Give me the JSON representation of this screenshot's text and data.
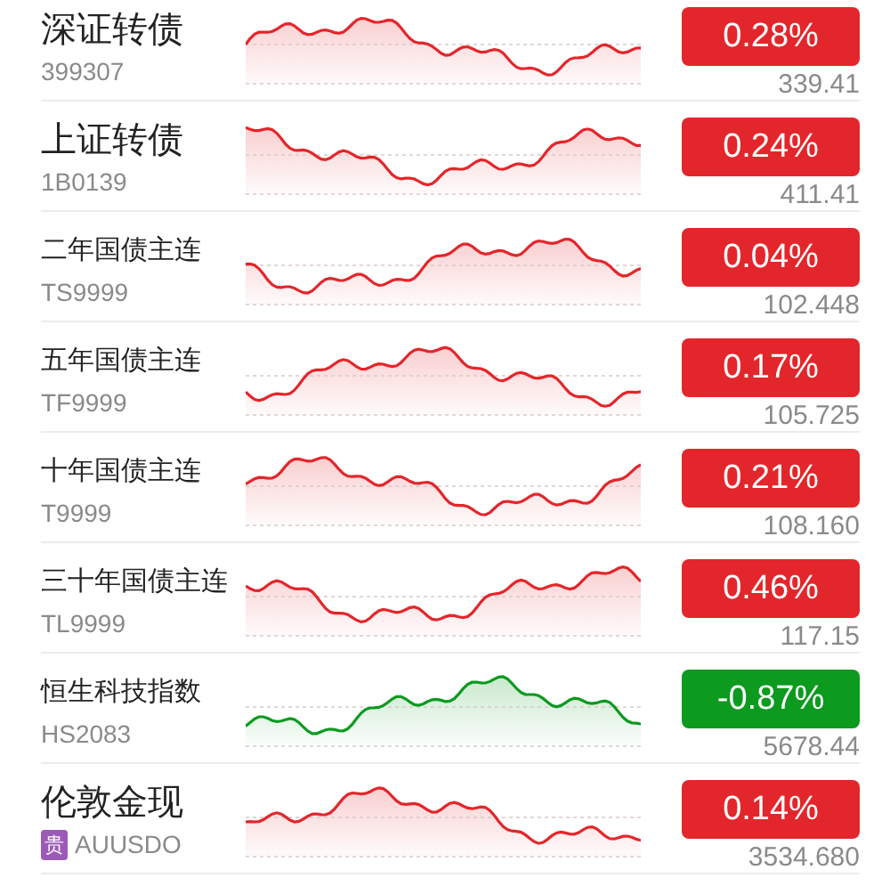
{
  "rows": [
    {
      "name": "深证转债",
      "code": "399307",
      "change": "0.28%",
      "price": "339.41",
      "color": "#e3262b"
    },
    {
      "name": "上证转债",
      "code": "1B0139",
      "change": "0.24%",
      "price": "411.41",
      "color": "#e3262b"
    },
    {
      "name": "二年国债主连",
      "code": "TS9999",
      "change": "0.04%",
      "price": "102.448",
      "color": "#e3262b"
    },
    {
      "name": "五年国债主连",
      "code": "TF9999",
      "change": "0.17%",
      "price": "105.725",
      "color": "#e3262b"
    },
    {
      "name": "十年国债主连",
      "code": "T9999",
      "change": "0.21%",
      "price": "108.160",
      "color": "#e3262b"
    },
    {
      "name": "三十年国债主连",
      "code": "TL9999",
      "change": "0.46%",
      "price": "117.15",
      "color": "#e3262b"
    },
    {
      "name": "恒生科技指数",
      "code": "HS2083",
      "change": "-0.87%",
      "price": "5678.44",
      "color": "#0c9a1f"
    },
    {
      "name": "伦敦金现",
      "code": "AUUSDO",
      "tag": "贵",
      "change": "0.14%",
      "price": "3534.680",
      "color": "#e3262b"
    }
  ]
}
